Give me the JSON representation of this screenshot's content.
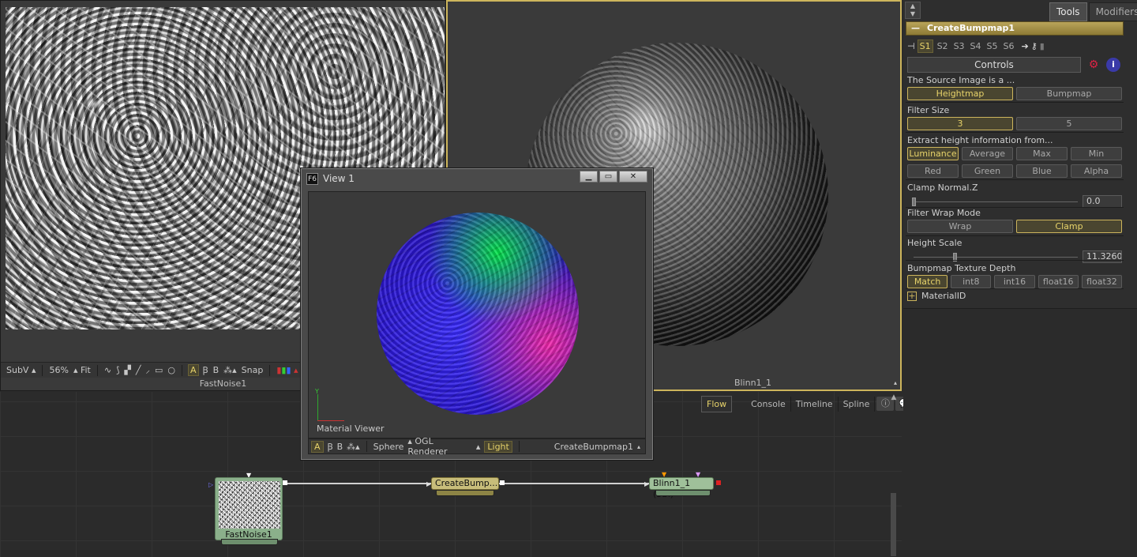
{
  "viewer_left": {
    "toolbar": {
      "subv": "SubV ▴",
      "zoom": "56%",
      "fit": "▴ Fit",
      "btn_a": "A",
      "btn_ab": "Ꞵ",
      "btn_b": "B",
      "btn_snap": "Snap",
      "btn_lut": "LU"
    },
    "caption": "FastNoise1"
  },
  "viewer_right": {
    "caption": "Blinn1_1"
  },
  "float_view": {
    "logo": "F6",
    "title": "View 1",
    "axis_y": "Y",
    "material_label": "Material Viewer",
    "toolbar": {
      "btn_a": "A",
      "btn_ab": "Ꞵ",
      "btn_b": "B",
      "sphere": "Sphere",
      "renderer": "▴ OGL Renderer",
      "light": "Light",
      "caption": "CreateBumpmap1"
    }
  },
  "flow": {
    "tabs": [
      "Flow",
      "Console",
      "Timeline",
      "Spline"
    ],
    "nodes": {
      "noise": "FastNoise1",
      "bump": "CreateBump...",
      "blinn": "Blinn1_1 (3Bl)"
    }
  },
  "right_panel": {
    "tabs": [
      "Tools",
      "Modifiers"
    ],
    "tool_title": "CreateBumpmap1",
    "slots": [
      "S1",
      "S2",
      "S3",
      "S4",
      "S5",
      "S6"
    ],
    "controls_label": "Controls",
    "source_label": "The Source Image is a ...",
    "source_options": [
      "Heightmap",
      "Bumpmap"
    ],
    "filter_size_label": "Filter Size",
    "filter_size_options": [
      "3",
      "5"
    ],
    "extract_label": "Extract height information from...",
    "extract_options_row1": [
      "Luminance",
      "Average",
      "Max",
      "Min"
    ],
    "extract_options_row2": [
      "Red",
      "Green",
      "Blue",
      "Alpha"
    ],
    "clamp_label": "Clamp Normal.Z",
    "clamp_value": "0.0",
    "clamp_level": 0.0,
    "wrap_label": "Filter Wrap Mode",
    "wrap_options": [
      "Wrap",
      "Clamp"
    ],
    "height_label": "Height Scale",
    "height_value": "11.32604",
    "height_level": 0.25,
    "depth_label": "Bumpmap Texture Depth",
    "depth_options": [
      "Match",
      "int8",
      "int16",
      "float16",
      "float32"
    ],
    "material_id": "MaterialID"
  },
  "colors": {
    "accent_yellow": "#cdb55c",
    "active_text": "#e7d36a"
  }
}
